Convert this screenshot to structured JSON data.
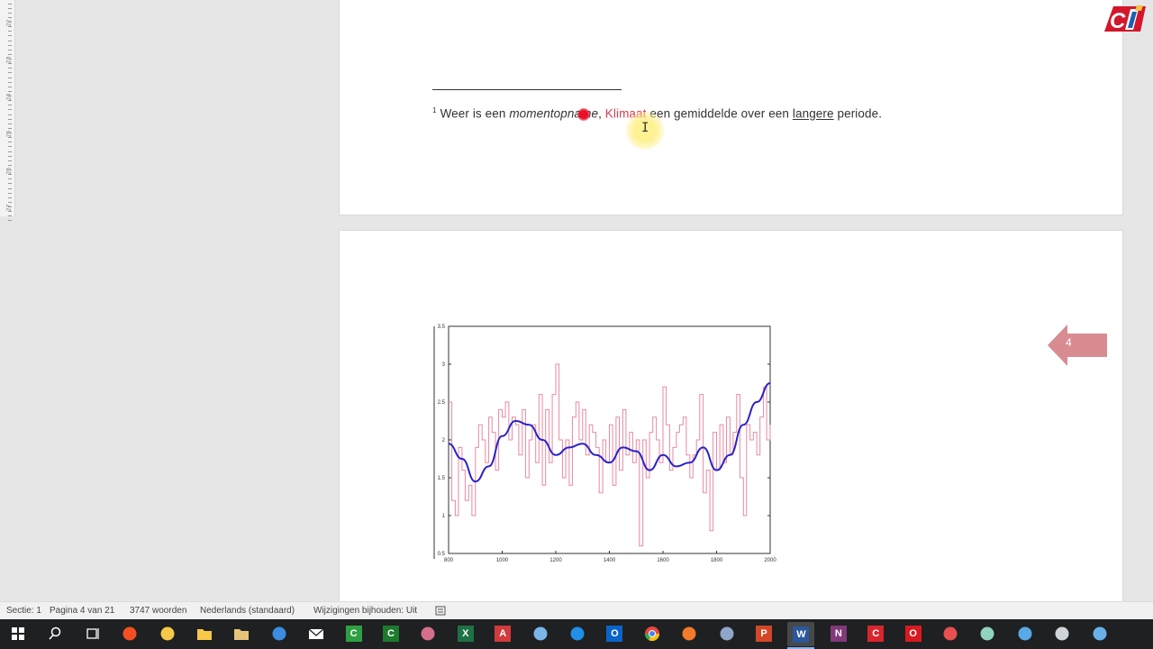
{
  "document": {
    "footnote": {
      "marker": "1",
      "p1": "Weer is een ",
      "p2_italic": "momentopname",
      "p3": ", ",
      "p4_red": "Klimaat",
      "p5": " een gemiddelde over een ",
      "p6_underline": "langere",
      "p7": " periode."
    }
  },
  "ruler_ticks": [
    "22",
    "23",
    "24",
    "25",
    "26",
    "27"
  ],
  "badge": {
    "label": "4",
    "color": "#d98b92"
  },
  "chart_data": {
    "type": "line",
    "title": "",
    "xlabel": "",
    "ylabel": "",
    "x_ticks": [
      "800",
      "1000",
      "1200",
      "1400",
      "1600",
      "1800",
      "2000"
    ],
    "y_ticks": [
      "0.5",
      "1",
      "1.5",
      "2",
      "2.5",
      "3",
      "3.5"
    ],
    "xlim": [
      800,
      2000
    ],
    "ylim": [
      0.5,
      3.5
    ],
    "series": [
      {
        "name": "",
        "color": "#e88aa0",
        "style": "step",
        "x": [
          800,
          812,
          825,
          837,
          850,
          862,
          875,
          887,
          900,
          912,
          925,
          937,
          950,
          962,
          975,
          987,
          1000,
          1012,
          1025,
          1037,
          1050,
          1062,
          1075,
          1087,
          1100,
          1112,
          1125,
          1137,
          1150,
          1162,
          1175,
          1187,
          1200,
          1212,
          1225,
          1237,
          1250,
          1262,
          1275,
          1287,
          1300,
          1312,
          1325,
          1337,
          1350,
          1362,
          1375,
          1387,
          1400,
          1412,
          1425,
          1437,
          1450,
          1462,
          1475,
          1487,
          1500,
          1512,
          1525,
          1537,
          1550,
          1562,
          1575,
          1587,
          1600,
          1612,
          1625,
          1637,
          1650,
          1662,
          1675,
          1687,
          1700,
          1712,
          1725,
          1737,
          1750,
          1762,
          1775,
          1787,
          1800,
          1812,
          1825,
          1837,
          1850,
          1862,
          1875,
          1887,
          1900,
          1912,
          1925,
          1937,
          1950,
          1962,
          1975,
          1987,
          2000
        ],
        "values": [
          2.5,
          1.2,
          1.0,
          1.9,
          1.6,
          1.2,
          1.4,
          1.0,
          1.9,
          2.2,
          2.0,
          1.7,
          2.3,
          2.1,
          1.6,
          2.4,
          2.3,
          2.5,
          2.0,
          2.3,
          2.2,
          1.8,
          2.4,
          1.5,
          2.0,
          2.2,
          1.7,
          2.6,
          1.4,
          2.4,
          1.7,
          2.6,
          3.0,
          2.0,
          1.5,
          2.0,
          1.4,
          2.3,
          2.5,
          2.0,
          2.4,
          1.8,
          2.2,
          2.1,
          1.9,
          1.3,
          2.0,
          1.7,
          2.2,
          1.4,
          2.3,
          1.6,
          2.4,
          1.8,
          2.1,
          1.7,
          2.0,
          0.6,
          2.0,
          1.5,
          2.1,
          2.3,
          2.0,
          1.7,
          2.7,
          2.2,
          1.6,
          1.9,
          2.1,
          2.2,
          2.3,
          1.8,
          1.5,
          1.8,
          2.0,
          2.6,
          1.3,
          1.6,
          0.8,
          2.1,
          1.6,
          2.2,
          1.7,
          2.3,
          1.8,
          2.1,
          2.6,
          1.5,
          1.0,
          2.2,
          2.0,
          2.1,
          1.8,
          2.3,
          2.7,
          2.0,
          2.2
        ]
      },
      {
        "name": "",
        "color": "#2a21c9",
        "style": "smooth",
        "x": [
          800,
          850,
          900,
          950,
          1000,
          1050,
          1100,
          1150,
          1200,
          1250,
          1300,
          1350,
          1400,
          1450,
          1500,
          1550,
          1600,
          1650,
          1700,
          1750,
          1800,
          1850,
          1900,
          1950,
          2000
        ],
        "values": [
          1.95,
          1.75,
          1.45,
          1.65,
          2.05,
          2.25,
          2.2,
          2.0,
          1.8,
          1.9,
          1.95,
          1.8,
          1.7,
          1.9,
          1.85,
          1.6,
          1.8,
          1.65,
          1.7,
          1.9,
          1.6,
          1.8,
          2.2,
          2.5,
          2.75
        ]
      }
    ]
  },
  "statusbar": {
    "section": "Sectie: 1",
    "page": "Pagina 4 van 21",
    "words": "3747 woorden",
    "language": "Nederlands (standaard)",
    "track_changes": "Wijzigingen bijhouden: Uit"
  },
  "taskbar": {
    "apps": [
      {
        "name": "start-button",
        "icon": "windows-logo-icon",
        "color": "#ffffff"
      },
      {
        "name": "search-button",
        "icon": "search-icon",
        "color": "#ffffff"
      },
      {
        "name": "task-view-button",
        "icon": "task-view-icon",
        "color": "#ffffff"
      },
      {
        "name": "store-app",
        "icon": "store-icon",
        "color": "#f25022"
      },
      {
        "name": "notepad-app",
        "icon": "document-icon",
        "color": "#f7c948"
      },
      {
        "name": "file-explorer-app",
        "icon": "folder-icon",
        "color": "#f7c948"
      },
      {
        "name": "files-app",
        "icon": "folder-icon",
        "color": "#e8c37a"
      },
      {
        "name": "app-blue",
        "icon": "app-icon",
        "color": "#3b8de0"
      },
      {
        "name": "mail-app",
        "icon": "mail-icon",
        "color": "#ffffff"
      },
      {
        "name": "camtasia-app",
        "icon": "c-icon",
        "color": "#2ea043"
      },
      {
        "name": "camtasia-recorder-app",
        "icon": "c-icon",
        "color": "#1c7a2c"
      },
      {
        "name": "app-pink",
        "icon": "app-icon",
        "color": "#d46f8a"
      },
      {
        "name": "excel-app",
        "icon": "excel-icon",
        "color": "#1e7145"
      },
      {
        "name": "acrobat-app",
        "icon": "acrobat-icon",
        "color": "#d13b3b"
      },
      {
        "name": "app-window",
        "icon": "window-icon",
        "color": "#7ab6e8"
      },
      {
        "name": "edge-app",
        "icon": "edge-icon",
        "color": "#1f8fe8"
      },
      {
        "name": "outlook-app",
        "icon": "outlook-icon",
        "color": "#0a64c8"
      },
      {
        "name": "chrome-app",
        "icon": "chrome-icon",
        "color": "#e8b13d"
      },
      {
        "name": "firefox-app",
        "icon": "firefox-icon",
        "color": "#f17b2a"
      },
      {
        "name": "app-screen",
        "icon": "screen-icon",
        "color": "#8fa6c8"
      },
      {
        "name": "powerpoint-app",
        "icon": "powerpoint-icon",
        "color": "#d24726"
      },
      {
        "name": "word-app",
        "icon": "word-icon",
        "color": "#2b579a"
      },
      {
        "name": "onenote-app",
        "icon": "onenote-icon",
        "color": "#80397b"
      },
      {
        "name": "camtasia-red-app",
        "icon": "c-icon",
        "color": "#d8262e"
      },
      {
        "name": "opera-app",
        "icon": "opera-icon",
        "color": "#d81b20"
      },
      {
        "name": "app-red-round",
        "icon": "app-icon",
        "color": "#e84f4f"
      },
      {
        "name": "app-feather",
        "icon": "feather-icon",
        "color": "#8fd3c0"
      },
      {
        "name": "app-globe",
        "icon": "globe-icon",
        "color": "#5aa9e6"
      },
      {
        "name": "app-camera",
        "icon": "camera-icon",
        "color": "#cfd4da"
      },
      {
        "name": "app-circle",
        "icon": "app-icon",
        "color": "#6ab0e8"
      }
    ],
    "labels": {
      "excel": "X",
      "acrobat": "A",
      "outlook": "O",
      "powerpoint": "P",
      "word": "W",
      "onenote": "N",
      "camtasia": "C",
      "opera": "O"
    }
  }
}
